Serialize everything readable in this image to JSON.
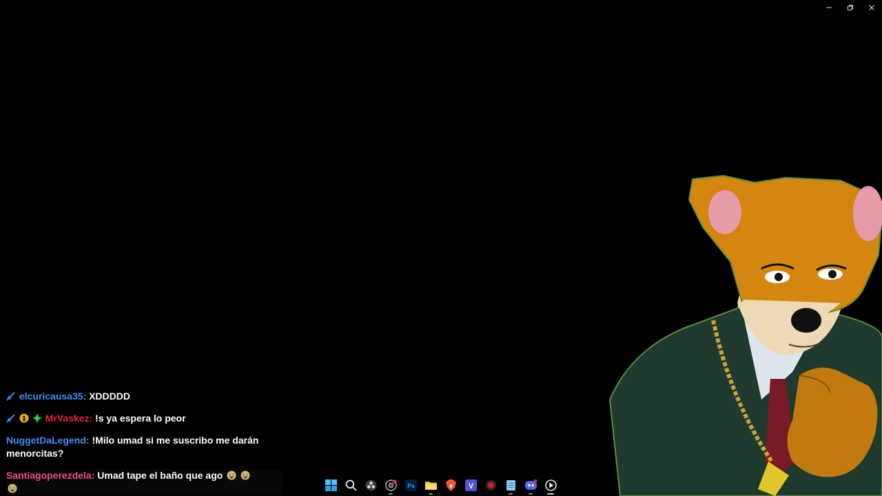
{
  "window_controls": {
    "minimize_icon": "minimize-icon",
    "restore_icon": "restore-icon",
    "close_icon": "close-icon"
  },
  "chat": {
    "messages": [
      {
        "badges": [
          "sword-badge"
        ],
        "user": "elcuricausa35:",
        "user_color": "#3f8ff5",
        "text": "XDDDDD"
      },
      {
        "badges": [
          "sword-badge",
          "gold-one-badge",
          "green-gem-badge"
        ],
        "user": "MrVaskez:",
        "user_color": "#e0243c",
        "text": "!s ya espera lo peor"
      },
      {
        "badges": [],
        "user": "NuggetDaLegend:",
        "user_color": "#3f8ff5",
        "text": "!Milo umad si me suscribo me darán menorcitas?"
      },
      {
        "badges": [],
        "user": "Santiagoperezdela:",
        "user_color": "#f0528c",
        "text": "Umad tape el baño que ago",
        "emotes": [
          "crying-emoji",
          "crying-emoji",
          "crying-emoji"
        ]
      }
    ]
  },
  "taskbar": {
    "icons": [
      "windows-start-icon",
      "search-icon",
      "obs-icon",
      "chrome-icon",
      "photoshop-icon",
      "file-explorer-icon",
      "brave-icon",
      "vegas-icon",
      "record-icon",
      "notepad-icon",
      "discord-icon",
      "media-player-icon"
    ],
    "photoshop_label": "Ps",
    "vegas_label": "V"
  },
  "colors": {
    "background": "#000000",
    "fur": "#d4860f",
    "suit": "#1f3a2f"
  }
}
